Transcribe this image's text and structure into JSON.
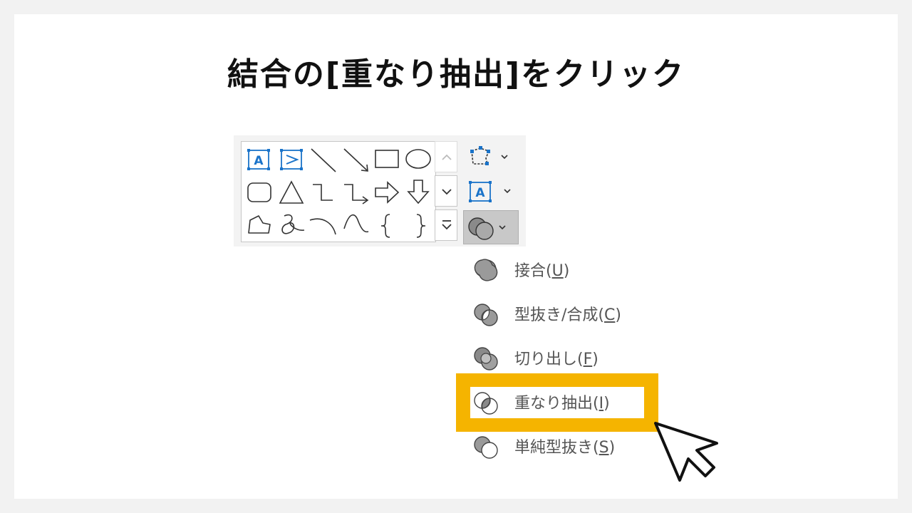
{
  "title": "結合の[重なり抽出]をクリック",
  "gallery": {
    "shapes": [
      "text-box-icon",
      "vertical-text-box-icon",
      "line-icon",
      "arrow-line-icon",
      "rectangle-icon",
      "oval-icon",
      "rounded-rectangle-icon",
      "triangle-icon",
      "elbow-connector-icon",
      "elbow-arrow-connector-icon",
      "right-arrow-icon",
      "down-arrow-icon",
      "freeform-icon",
      "scribble-icon",
      "arc-icon",
      "curve-icon",
      "left-brace-icon",
      "right-brace-icon"
    ],
    "scroll": [
      "scroll-up-icon",
      "scroll-down-icon",
      "more-icon"
    ]
  },
  "ribbon_buttons": [
    "edit-shape-icon",
    "text-box-icon",
    "merge-shapes-icon"
  ],
  "menu": {
    "items": [
      {
        "pre": "接合(",
        "key": "U",
        "post": ")",
        "icon": "union-icon"
      },
      {
        "pre": "型抜き/合成(",
        "key": "C",
        "post": ")",
        "icon": "combine-icon"
      },
      {
        "pre": "切り出し(",
        "key": "F",
        "post": ")",
        "icon": "fragment-icon"
      },
      {
        "pre": "重なり抽出(",
        "key": "I",
        "post": ")",
        "icon": "intersect-icon"
      },
      {
        "pre": "単純型抜き(",
        "key": "S",
        "post": ")",
        "icon": "subtract-icon"
      }
    ],
    "highlighted_index": 3,
    "highlight_color": "#f5b400"
  }
}
